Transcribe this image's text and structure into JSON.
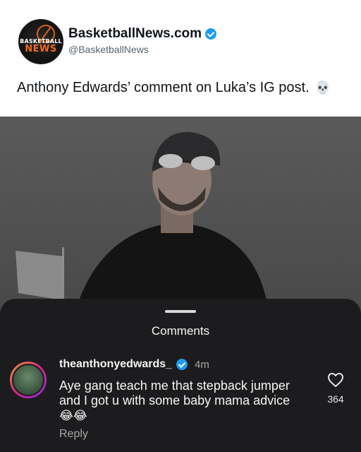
{
  "post": {
    "account_name": "BasketballNews.com",
    "handle": "@BasketballNews",
    "text": "Anthony Edwards’ comment on Luka’s IG post.",
    "emoji": "💀",
    "logo_line1": "BASKETBALL",
    "logo_line2": "NEWS"
  },
  "comments_sheet": {
    "title": "Comments",
    "comment": {
      "username": "theanthonyedwards_",
      "time": "4m",
      "text": "Aye gang teach me that stepback jumper and I got u with some baby mama advice",
      "emoji": "😂😂",
      "reply_label": "Reply",
      "like_count": "364"
    }
  },
  "colors": {
    "verified": "#1d9bf0",
    "sheet_bg": "#1c1c1e",
    "logo_accent": "#f26b1d"
  },
  "icons": [
    "verified-badge-icon",
    "heart-icon",
    "skull-emoji"
  ]
}
